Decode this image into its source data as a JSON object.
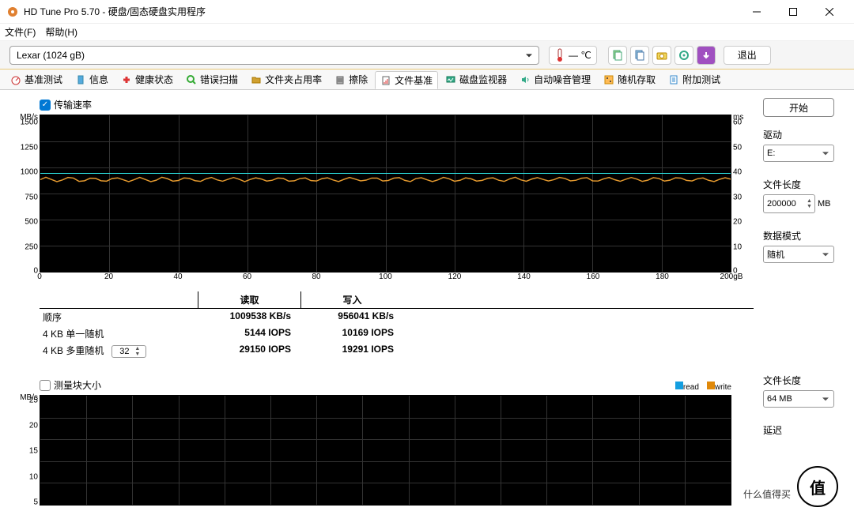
{
  "window": {
    "title": "HD Tune Pro 5.70 - 硬盘/固态硬盘实用程序"
  },
  "menu": {
    "file": "文件(F)",
    "help": "帮助(H)"
  },
  "toolbar": {
    "drive": "Lexar (1024 gB)",
    "temp": "— ℃",
    "exit": "退出",
    "icons": [
      "copy-info-icon",
      "copy-shot-icon",
      "camera-icon",
      "options-icon",
      "save-icon"
    ]
  },
  "tabs": [
    {
      "name": "benchmark",
      "label": "基准测试"
    },
    {
      "name": "info",
      "label": "信息"
    },
    {
      "name": "health",
      "label": "健康状态"
    },
    {
      "name": "errorscan",
      "label": "错误扫描"
    },
    {
      "name": "folderusage",
      "label": "文件夹占用率"
    },
    {
      "name": "erase",
      "label": "擦除"
    },
    {
      "name": "filebenchmark",
      "label": "文件基准"
    },
    {
      "name": "monitor",
      "label": "磁盘监视器"
    },
    {
      "name": "aam",
      "label": "自动噪音管理"
    },
    {
      "name": "random",
      "label": "随机存取"
    },
    {
      "name": "extra",
      "label": "附加测试"
    }
  ],
  "section1": {
    "check_label": "传输速率"
  },
  "chart_data": {
    "type": "line",
    "title": "",
    "xlabel": "gB",
    "ylabel_left": "MB/s",
    "ylabel_right": "ms",
    "x_ticks": [
      0,
      20,
      40,
      60,
      80,
      100,
      120,
      140,
      160,
      180,
      "200gB"
    ],
    "y_left_ticks": [
      0,
      250,
      500,
      750,
      1000,
      1250,
      1500
    ],
    "y_right_ticks": [
      0,
      10,
      20,
      30,
      40,
      50,
      60
    ],
    "ylim_left": [
      0,
      1500
    ],
    "ylim_right": [
      0,
      60
    ],
    "series": [
      {
        "name": "read",
        "color": "#2de1e1",
        "values_approx": 947,
        "unit": "MB/s"
      },
      {
        "name": "write",
        "color": "#e59a2f",
        "values_approx": 880,
        "unit": "MB/s"
      }
    ]
  },
  "results": {
    "head": {
      "c1": "",
      "c2": "读取",
      "c3": "写入"
    },
    "rows": [
      {
        "label": "顺序",
        "read": "1009538 KB/s",
        "write": "956041 KB/s"
      },
      {
        "label": "4 KB 单一随机",
        "read": "5144 IOPS",
        "write": "10169 IOPS"
      },
      {
        "label": "4 KB 多重随机",
        "qd": "32",
        "read": "29150 IOPS",
        "write": "19291 IOPS"
      }
    ]
  },
  "section2": {
    "check_label": "测量块大小",
    "legend_read": "read",
    "legend_write": "write"
  },
  "chart2_data": {
    "type": "bar",
    "ylabel": "MB/s",
    "y_ticks": [
      5,
      10,
      15,
      20,
      25
    ],
    "ylim": [
      0,
      25
    ]
  },
  "side": {
    "start": "开始",
    "drive_label": "驱动",
    "drive_value": "E:",
    "filelen_label": "文件长度",
    "filelen_value": "200000",
    "filelen_unit": "MB",
    "datamode_label": "数据模式",
    "datamode_value": "随机",
    "filelen2_label": "文件长度",
    "filelen2_value": "64 MB",
    "delay_label": "延迟"
  },
  "watermark": {
    "glyph": "值",
    "text": "什么值得买"
  }
}
